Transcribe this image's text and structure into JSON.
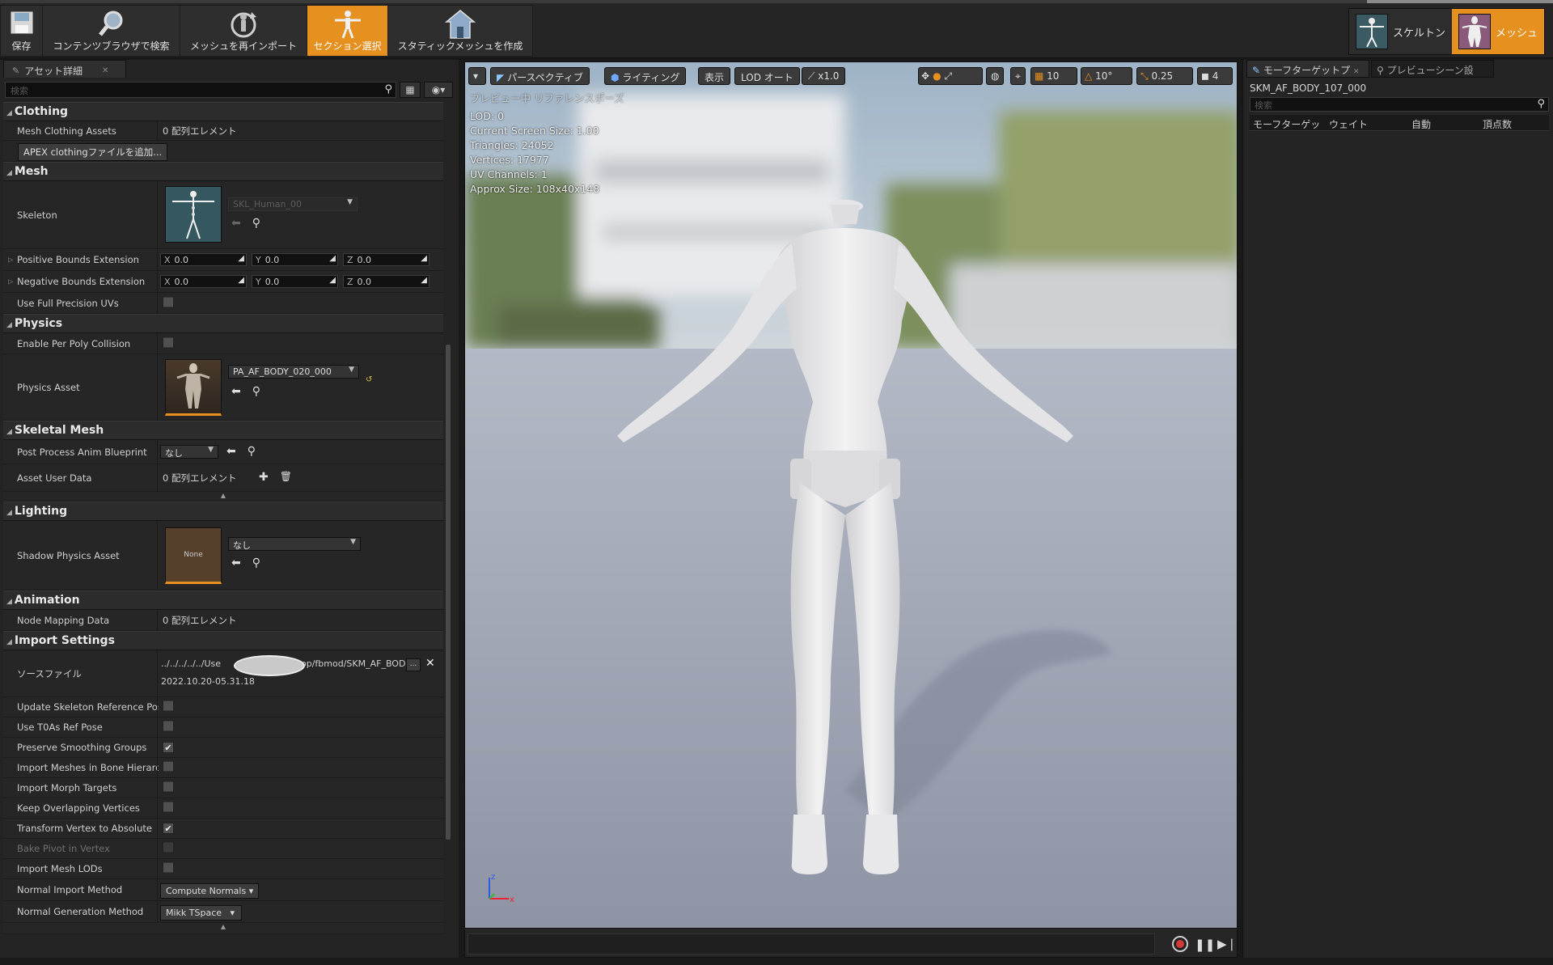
{
  "toolbar": {
    "buttons": [
      {
        "label": "保存",
        "icon": "save-icon"
      },
      {
        "label": "コンテンツブラウザで検索",
        "icon": "magnifier-icon"
      },
      {
        "label": "メッシュを再インポート",
        "icon": "reimport-icon"
      },
      {
        "label": "セクション選択",
        "icon": "section-select-icon",
        "active": true
      },
      {
        "label": "スタティックメッシュを作成",
        "icon": "house-icon"
      }
    ],
    "modes": [
      {
        "label": "スケルトン",
        "icon": "skeleton-mode-icon"
      },
      {
        "label": "メッシュ",
        "icon": "mesh-mode-icon",
        "active": true
      }
    ]
  },
  "left_panel": {
    "tab": "アセット詳細",
    "search_placeholder": "検索",
    "categories": {
      "clothing": "Clothing",
      "mesh": "Mesh",
      "physics": "Physics",
      "skeletal_mesh": "Skeletal Mesh",
      "lighting": "Lighting",
      "animation": "Animation",
      "import_settings": "Import Settings"
    },
    "clothing": {
      "mesh_clothing_assets": "Mesh Clothing Assets",
      "mesh_clothing_assets_value": "0 配列エレメント",
      "apex_button": "APEX clothingファイルを追加..."
    },
    "mesh": {
      "skeleton": "Skeleton",
      "skeleton_value": "SKL_Human_00",
      "positive_bounds": "Positive Bounds Extension",
      "negative_bounds": "Negative Bounds Extension",
      "axes": [
        "X",
        "Y",
        "Z"
      ],
      "positive_values": [
        "0.0",
        "0.0",
        "0.0"
      ],
      "negative_values": [
        "0.0",
        "0.0",
        "0.0"
      ],
      "full_precision_uvs": "Use Full Precision UVs"
    },
    "physics": {
      "per_poly": "Enable Per Poly Collision",
      "physics_asset": "Physics Asset",
      "physics_asset_value": "PA_AF_BODY_020_000"
    },
    "skeletal_mesh": {
      "post_process": "Post Process Anim Blueprint",
      "post_process_value": "なし",
      "asset_user_data": "Asset User Data",
      "asset_user_data_value": "0 配列エレメント"
    },
    "lighting": {
      "shadow_physics": "Shadow Physics Asset",
      "shadow_value": "なし",
      "thumb_text": "None"
    },
    "animation": {
      "node_mapping": "Node Mapping Data",
      "node_mapping_value": "0 配列エレメント"
    },
    "import": {
      "source_file": "ソースファイル",
      "source_path_left": "../../../../../Use",
      "source_path_right": "op/fbmod/SKM_AF_BOD",
      "source_date": "2022.10.20-05.31.18",
      "browse": "...",
      "rows": [
        {
          "label": "Update Skeleton Reference Pose",
          "checked": false,
          "dim": false
        },
        {
          "label": "Use T0As Ref Pose",
          "checked": false,
          "dim": false
        },
        {
          "label": "Preserve Smoothing Groups",
          "checked": true,
          "dim": false
        },
        {
          "label": "Import Meshes in Bone Hierarchy",
          "checked": false,
          "dim": false
        },
        {
          "label": "Import Morph Targets",
          "checked": false,
          "dim": false
        },
        {
          "label": "Keep Overlapping Vertices",
          "checked": false,
          "dim": false
        },
        {
          "label": "Transform Vertex to Absolute",
          "checked": true,
          "dim": false
        },
        {
          "label": "Bake Pivot in Vertex",
          "checked": false,
          "dim": true
        },
        {
          "label": "Import Mesh LODs",
          "checked": false,
          "dim": false
        }
      ],
      "normal_import": "Normal Import Method",
      "normal_import_value": "Compute Normals",
      "normal_generation": "Normal Generation Method",
      "normal_generation_value": "Mikk TSpace"
    }
  },
  "viewport": {
    "perspective": "パースペクティブ",
    "lighting": "ライティング",
    "show": "表示",
    "lod": "LOD オート",
    "speed": "x1.0",
    "grid_snap": "10",
    "rot_snap": "10°",
    "scale_snap": "0.25",
    "cam_speed": "4",
    "preview_text": "プレビュー中 リファレンスポーズ",
    "stats": [
      "LOD: 0",
      "Current Screen Size: 1.00",
      "Triangles: 24052",
      "Vertices: 17977",
      "UV Channels: 1",
      "Approx Size: 108x40x148"
    ]
  },
  "right_panel": {
    "tab1": "モーフターゲットプ",
    "tab2": "プレビューシーン設",
    "asset_name": "SKM_AF_BODY_107_000",
    "search_placeholder": "検索",
    "columns": [
      "モーフターゲッ",
      "ウェイト",
      "自動",
      "頂点数"
    ]
  }
}
